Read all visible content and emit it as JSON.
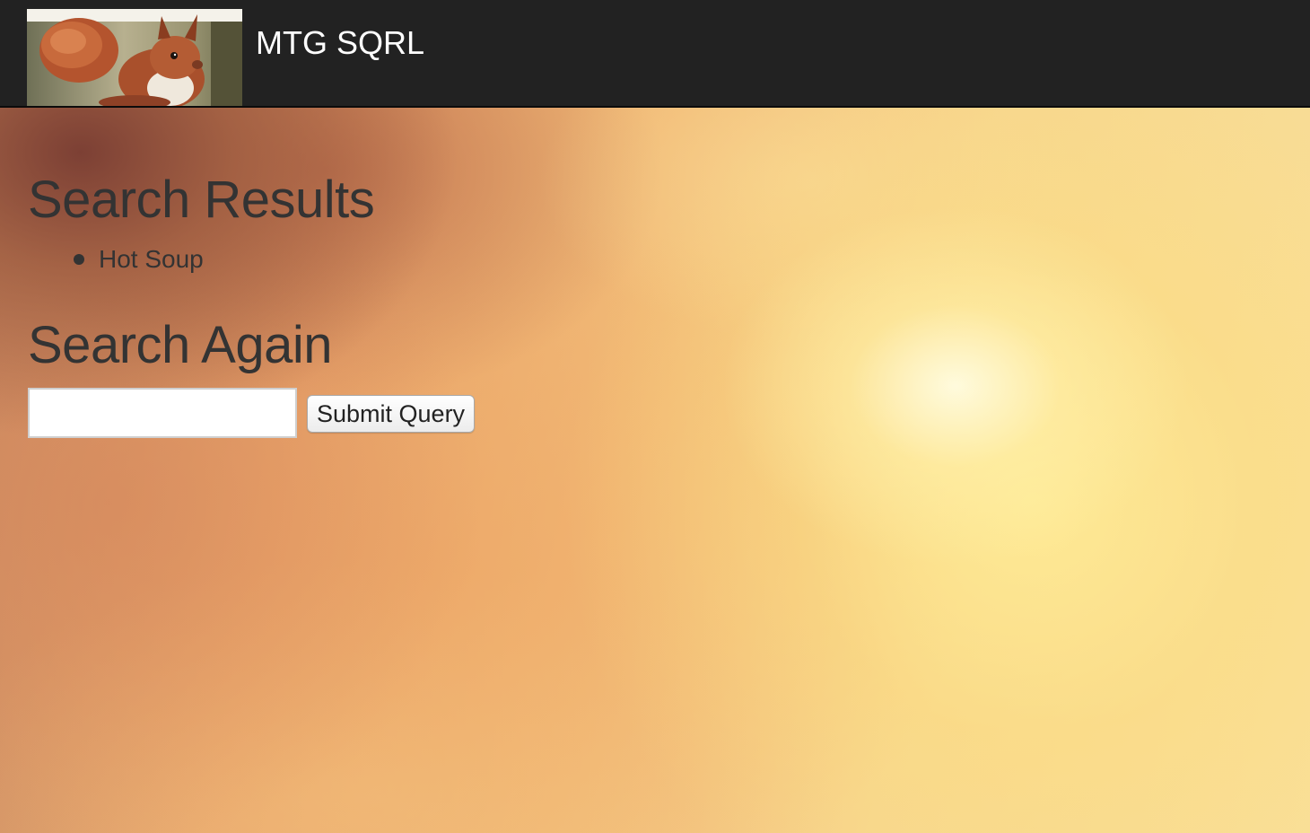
{
  "navbar": {
    "brand": "MTG SQRL",
    "logo_icon": "squirrel-logo"
  },
  "results": {
    "heading": "Search Results",
    "items": [
      "Hot Soup"
    ]
  },
  "search_again": {
    "heading": "Search Again",
    "input_value": "",
    "button_label": "Submit Query"
  }
}
